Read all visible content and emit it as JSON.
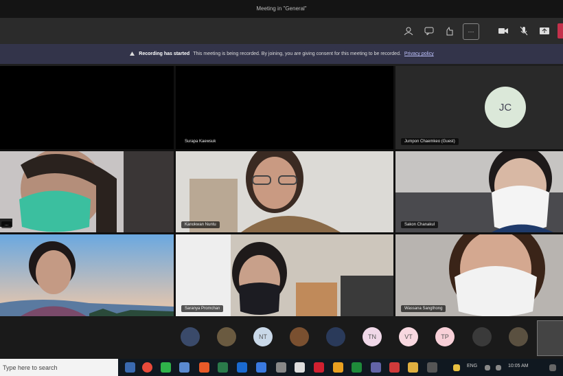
{
  "window": {
    "title": "Meeting in \"General\""
  },
  "toolbar": {
    "more_label": "···"
  },
  "banner": {
    "bold": "Recording has started",
    "text": "This meeting is being recorded. By joining, you are giving consent for this meeting to be recorded.",
    "link": "Privacy policy"
  },
  "tiles": {
    "t2": {
      "name": "Surapa Kaewsuk"
    },
    "t3": {
      "name": "Jumpon Chaemkeo (Guest)",
      "initials": "JC"
    },
    "t4": {
      "name": "..."
    },
    "t5": {
      "name": "Kanokwan Nuntu"
    },
    "t6": {
      "name": "Sakon Chanakul"
    },
    "t8": {
      "name": "Saranya Promchan"
    },
    "t9": {
      "name": "Wassana Sangthong"
    }
  },
  "participants_bar": [
    {
      "initials": "",
      "color": "#3a4a6a"
    },
    {
      "initials": "",
      "color": "#6a5a40"
    },
    {
      "initials": "NT",
      "color": "#c9d8e8"
    },
    {
      "initials": "",
      "color": "#7a5030"
    },
    {
      "initials": "",
      "color": "#2a3a5a"
    },
    {
      "initials": "TN",
      "color": "#f0d8e8"
    },
    {
      "initials": "VT",
      "color": "#f8d8e0"
    },
    {
      "initials": "TP",
      "color": "#f8d0d8"
    },
    {
      "initials": "",
      "color": "#3a3a3a"
    },
    {
      "initials": "",
      "color": "#5a5040"
    }
  ],
  "taskbar": {
    "search_placeholder": "Type here to search",
    "lang": "ENG",
    "time": "10:05 AM"
  }
}
